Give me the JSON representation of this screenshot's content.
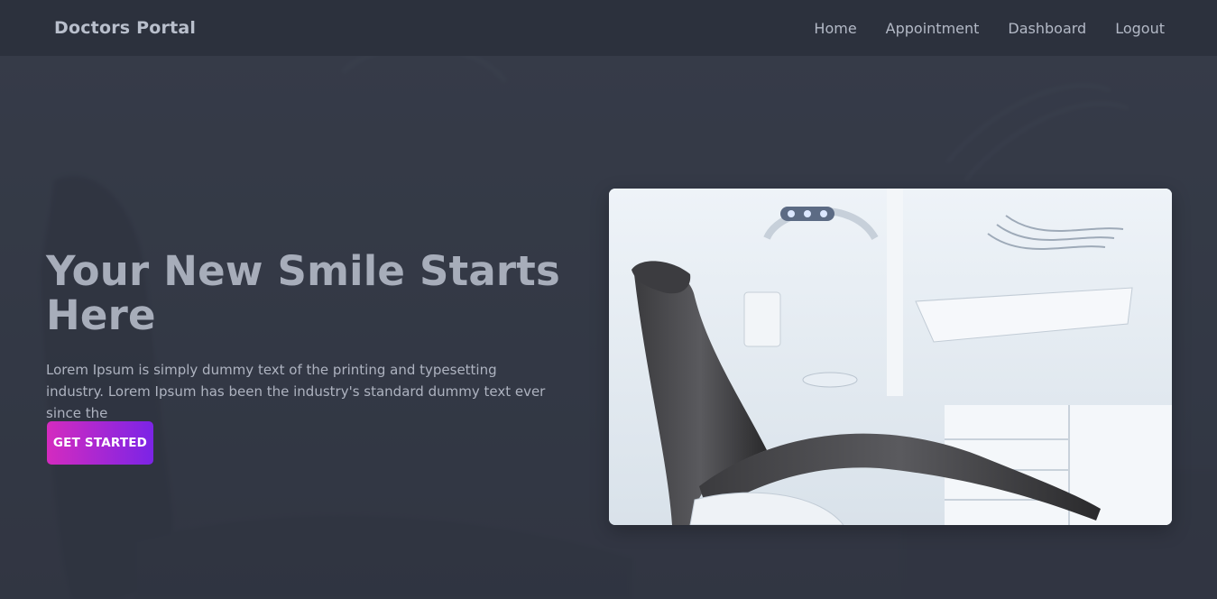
{
  "navbar": {
    "brand": "Doctors Portal",
    "links": [
      {
        "label": "Home"
      },
      {
        "label": "Appointment"
      },
      {
        "label": "Dashboard"
      },
      {
        "label": "Logout"
      }
    ]
  },
  "hero": {
    "title": "Your New Smile Starts Here",
    "description": "Lorem Ipsum is simply dummy text of the printing and typesetting industry. Lorem Ipsum has been the industry's standard dummy text ever since the",
    "cta_label": "GET STARTED"
  },
  "colors": {
    "navbar_bg": "#2c313d",
    "page_bg": "#3a3f4c",
    "cta_gradient_start": "#d42bbf",
    "cta_gradient_end": "#7b24e6"
  }
}
